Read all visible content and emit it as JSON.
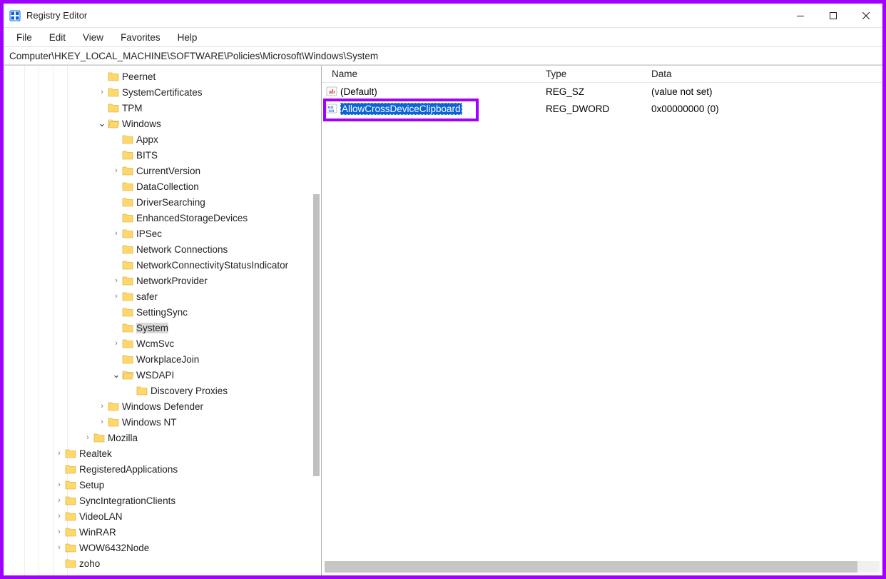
{
  "title": "Registry Editor",
  "menubar": [
    "File",
    "Edit",
    "View",
    "Favorites",
    "Help"
  ],
  "address": "Computer\\HKEY_LOCAL_MACHINE\\SOFTWARE\\Policies\\Microsoft\\Windows\\System",
  "columns": {
    "name": "Name",
    "type": "Type",
    "data": "Data"
  },
  "values": [
    {
      "icon": "string",
      "name": "(Default)",
      "type": "REG_SZ",
      "data": "(value not set)",
      "selected": false
    },
    {
      "icon": "dword",
      "name": "AllowCrossDeviceClipboard",
      "type": "REG_DWORD",
      "data": "0x00000000 (0)",
      "selected": true
    }
  ],
  "tree": [
    {
      "d": 6,
      "exp": "",
      "label": "Peernet"
    },
    {
      "d": 6,
      "exp": ">",
      "label": "SystemCertificates"
    },
    {
      "d": 6,
      "exp": "",
      "label": "TPM"
    },
    {
      "d": 6,
      "exp": "v",
      "label": "Windows",
      "open": true
    },
    {
      "d": 7,
      "exp": "",
      "label": "Appx"
    },
    {
      "d": 7,
      "exp": "",
      "label": "BITS"
    },
    {
      "d": 7,
      "exp": ">",
      "label": "CurrentVersion"
    },
    {
      "d": 7,
      "exp": "",
      "label": "DataCollection"
    },
    {
      "d": 7,
      "exp": "",
      "label": "DriverSearching"
    },
    {
      "d": 7,
      "exp": "",
      "label": "EnhancedStorageDevices"
    },
    {
      "d": 7,
      "exp": ">",
      "label": "IPSec"
    },
    {
      "d": 7,
      "exp": "",
      "label": "Network Connections"
    },
    {
      "d": 7,
      "exp": "",
      "label": "NetworkConnectivityStatusIndicator"
    },
    {
      "d": 7,
      "exp": ">",
      "label": "NetworkProvider"
    },
    {
      "d": 7,
      "exp": ">",
      "label": "safer"
    },
    {
      "d": 7,
      "exp": "",
      "label": "SettingSync"
    },
    {
      "d": 7,
      "exp": "",
      "label": "System",
      "selected": true
    },
    {
      "d": 7,
      "exp": ">",
      "label": "WcmSvc"
    },
    {
      "d": 7,
      "exp": "",
      "label": "WorkplaceJoin"
    },
    {
      "d": 7,
      "exp": "v",
      "label": "WSDAPI",
      "open": true
    },
    {
      "d": 8,
      "exp": "",
      "label": "Discovery Proxies"
    },
    {
      "d": 6,
      "exp": ">",
      "label": "Windows Defender"
    },
    {
      "d": 6,
      "exp": ">",
      "label": "Windows NT"
    },
    {
      "d": 5,
      "exp": ">",
      "label": "Mozilla"
    },
    {
      "d": 3,
      "exp": ">",
      "label": "Realtek"
    },
    {
      "d": 3,
      "exp": "",
      "label": "RegisteredApplications"
    },
    {
      "d": 3,
      "exp": ">",
      "label": "Setup"
    },
    {
      "d": 3,
      "exp": ">",
      "label": "SyncIntegrationClients"
    },
    {
      "d": 3,
      "exp": ">",
      "label": "VideoLAN"
    },
    {
      "d": 3,
      "exp": ">",
      "label": "WinRAR"
    },
    {
      "d": 3,
      "exp": ">",
      "label": "WOW6432Node"
    },
    {
      "d": 3,
      "exp": "",
      "label": "zoho"
    }
  ]
}
